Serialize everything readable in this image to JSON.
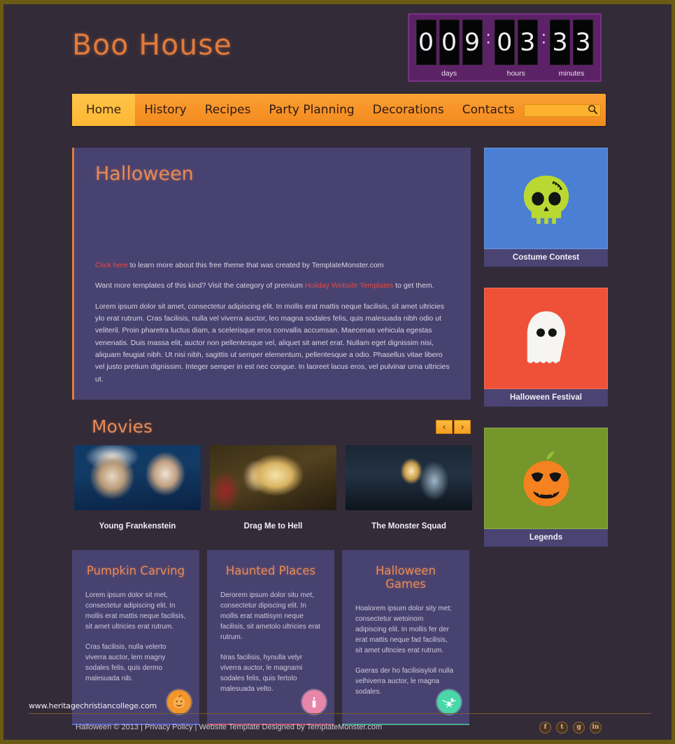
{
  "site": {
    "logo": "Boo House",
    "accent_orange": "#e07b3c",
    "nav_orange": "#f79327",
    "panel_purple": "#484270"
  },
  "countdown": {
    "days": {
      "label": "days",
      "digits": [
        "0",
        "0",
        "9"
      ]
    },
    "hours": {
      "label": "hours",
      "digits": [
        "0",
        "3"
      ]
    },
    "minutes": {
      "label": "minutes",
      "digits": [
        "3",
        "3"
      ]
    },
    "separator": ":"
  },
  "nav": {
    "items": [
      {
        "label": "Home",
        "active": true
      },
      {
        "label": "History",
        "active": false
      },
      {
        "label": "Recipes",
        "active": false
      },
      {
        "label": "Party Planning",
        "active": false
      },
      {
        "label": "Decorations",
        "active": false
      },
      {
        "label": "Contacts",
        "active": false
      }
    ]
  },
  "search": {
    "value": "",
    "placeholder": "",
    "icon": "search-icon"
  },
  "hero": {
    "title": "Halloween",
    "line1_link": "Click here",
    "line1_rest": " to learn more about this free theme that was created by TemplateMonster.com",
    "line2_pre": "Want more templates of this kind? Visit the category of premium ",
    "line2_link": "Holiday Website Templates",
    "line2_post": " to get them.",
    "body": "Lorem ipsum dolor sit amet, consectetur adipiscing elit. In mollis erat mattis neque facilisis, sit amet ultricies ylo erat rutrum. Cras facilisis, nulla vel viverra auctor, leo magna sodales felis, quis malesuada nibh odio ut veliteril. Proin pharetra luctus diam, a scelerisque eros convallis accumsan. Maecenas vehicula egestas venenatis. Duis massa elit, auctor non pellentesque vel, aliquet sit amet erat. Nullam eget dignissim nisi, aliquam feugiat nibh. Ut nisi nibh, sagittis ut semper elementum, pellentesque a odio. Phasellus vitae libero vel justo pretium dignissim. Integer semper in est nec congue. In laoreet lacus eros, vel pulvinar urna ultricies ut."
  },
  "movies": {
    "title": "Movies",
    "prev": "‹",
    "next": "›",
    "items": [
      {
        "caption": "Young Frankenstein",
        "poster": "young-frankenstein-poster"
      },
      {
        "caption": "Drag Me to Hell",
        "poster": "drag-me-to-hell-poster"
      },
      {
        "caption": "The Monster Squad",
        "poster": "the-monster-squad-poster"
      }
    ]
  },
  "cards": [
    {
      "title": "Pumpkin Carving",
      "p1": "Lorem ipsum dolor sit met, consectetur adipiscing elit. In mollis erat mattis neque facilisis, sit amet ultricies erat rutrum.",
      "p2": "Cras facilisis, nulla velerto viverra auctor, lem magny sodales felis, quis dermo malesuada nib.",
      "icon": "pumpkin-icon",
      "icon_color": "#f2952a",
      "rule_color": "#5f6bd0"
    },
    {
      "title": "Haunted Places",
      "p1": "Derorem ipsum dolor situ met, consectetur dipiscing elit. In mollis erat mattisym neque facilisis, sit ametolo ultricies erat rutrum.",
      "p2": "Nras facilisis, hynulla velyr viverra auctor, le magnami sodales felis, quis fertolo malesuada velto.",
      "icon": "candle-icon",
      "icon_color": "#e886aa",
      "rule_color": "#c15a7a"
    },
    {
      "title": "Halloween Games",
      "p1": "Hoalorem ipsum dolor sity met; consectetur wetoinom adipiscing elit. In mollis fer der erat mattis neque fad facilisis, sit amet ultncies erat rutrum.",
      "p2": "Gaeras der ho facilisisyloll nulla velhiverra auctor, le magna sodales.",
      "icon": "spider-icon",
      "icon_color": "#49d7aa",
      "rule_color": "#4aa98e"
    }
  ],
  "sidebar": [
    {
      "caption": "Costume Contest",
      "icon": "skull-icon",
      "bg": "#4a7fd4"
    },
    {
      "caption": "Halloween Festival",
      "icon": "ghost-icon",
      "bg": "#ef5138"
    },
    {
      "caption": "Legends",
      "icon": "jack-o-lantern-icon",
      "bg": "#74962a"
    }
  ],
  "footer": {
    "watermark": "www.heritagechristiancollege.com",
    "copyright": "Halloween © 2013 | Privacy Policy | Website Template Designed by TemplateMonster.com",
    "socials": [
      {
        "name": "facebook-icon",
        "glyph": "f"
      },
      {
        "name": "twitter-icon",
        "glyph": "t"
      },
      {
        "name": "google-plus-icon",
        "glyph": "g"
      },
      {
        "name": "linkedin-icon",
        "glyph": "in"
      }
    ]
  }
}
